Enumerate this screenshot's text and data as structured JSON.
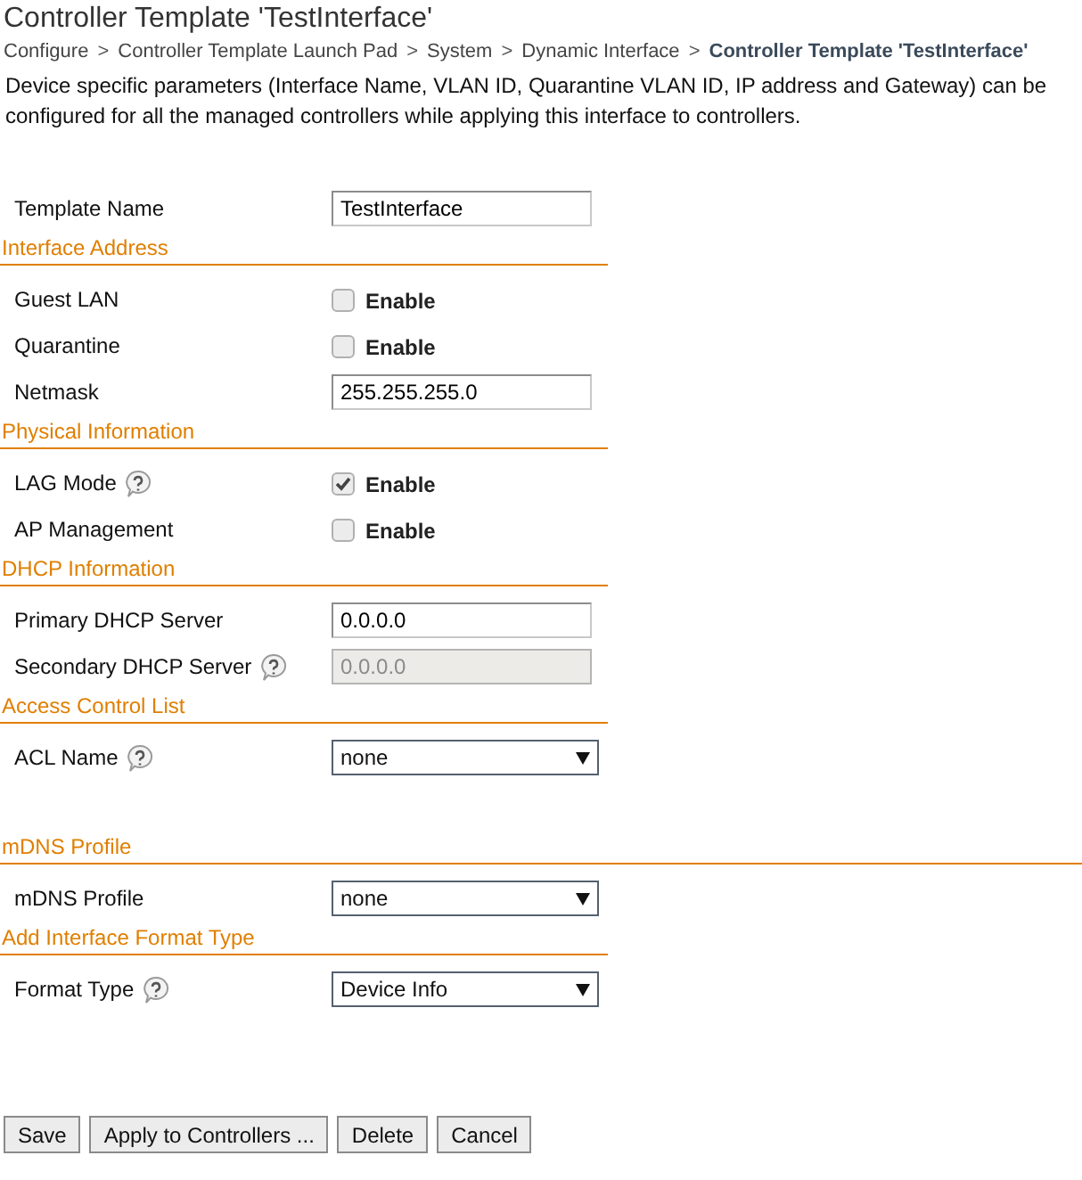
{
  "title": "Controller Template 'TestInterface'",
  "breadcrumb": [
    {
      "label": "Configure",
      "current": false
    },
    {
      "label": "Controller Template Launch Pad",
      "current": false
    },
    {
      "label": "System",
      "current": false
    },
    {
      "label": "Dynamic Interface",
      "current": false
    },
    {
      "label": "Controller Template 'TestInterface'",
      "current": true
    }
  ],
  "breadcrumb_separator": ">",
  "description": "Device specific parameters (Interface Name, VLAN ID, Quarantine VLAN ID, IP address and Gateway) can be configured for all the managed controllers while applying this interface to controllers.",
  "top_fields": [
    {
      "kind": "text",
      "label": "Template Name",
      "value": "TestInterface",
      "help": false,
      "disabled": false
    }
  ],
  "sections": [
    {
      "title": "Interface Address",
      "rows": [
        {
          "kind": "checkbox",
          "label": "Guest LAN",
          "option": "Enable",
          "checked": false,
          "help": false
        },
        {
          "kind": "checkbox",
          "label": "Quarantine",
          "option": "Enable",
          "checked": false,
          "help": false
        },
        {
          "kind": "text",
          "label": "Netmask",
          "value": "255.255.255.0",
          "help": false,
          "disabled": false
        }
      ]
    },
    {
      "title": "Physical Information",
      "rows": [
        {
          "kind": "checkbox",
          "label": "LAG Mode",
          "option": "Enable",
          "checked": true,
          "help": true
        },
        {
          "kind": "checkbox",
          "label": "AP Management",
          "option": "Enable",
          "checked": false,
          "help": false
        }
      ]
    },
    {
      "title": "DHCP Information",
      "rows": [
        {
          "kind": "text",
          "label": "Primary DHCP Server",
          "value": "0.0.0.0",
          "help": false,
          "disabled": false
        },
        {
          "kind": "text",
          "label": "Secondary DHCP Server",
          "value": "0.0.0.0",
          "help": true,
          "disabled": true
        }
      ]
    },
    {
      "title": "Access Control List",
      "rows": [
        {
          "kind": "select",
          "label": "ACL Name",
          "value": "none",
          "help": true
        }
      ]
    },
    {
      "title": "mDNS Profile",
      "rows": [
        {
          "kind": "select",
          "label": "mDNS Profile",
          "value": "none",
          "help": false
        }
      ]
    },
    {
      "title": "Add Interface Format Type",
      "rows": [
        {
          "kind": "select",
          "label": "Format Type",
          "value": "Device Info",
          "help": true
        }
      ]
    }
  ],
  "buttons": [
    "Save",
    "Apply to Controllers ...",
    "Delete",
    "Cancel"
  ]
}
